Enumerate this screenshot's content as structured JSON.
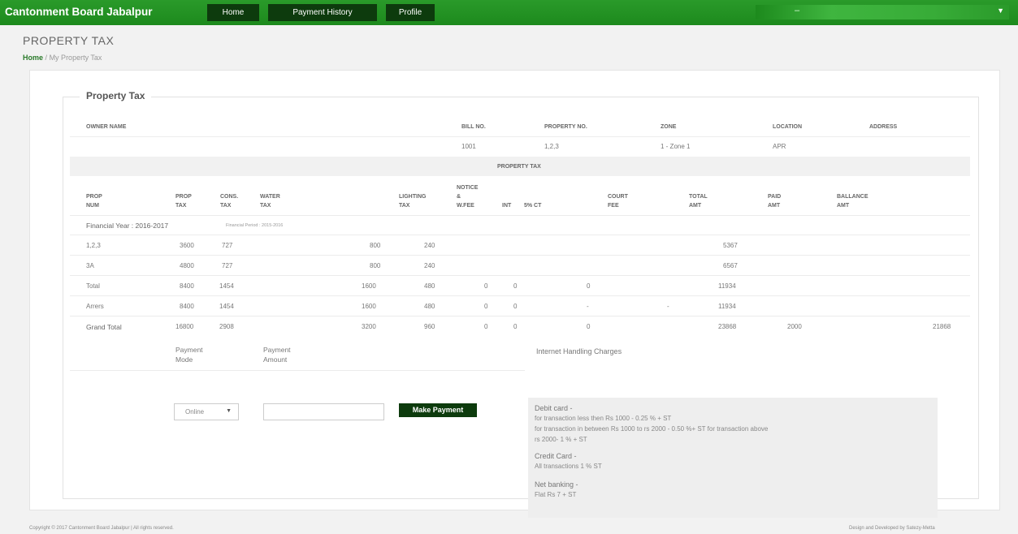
{
  "brand": "Cantonment Board Jabalpur",
  "nav": {
    "home": "Home",
    "payment_history": "Payment History",
    "profile": "Profile"
  },
  "user": {
    "name": "–",
    "caret": "▼"
  },
  "page": {
    "title": "PROPERTY TAX",
    "breadcrumb_home": "Home",
    "breadcrumb_sep": "/",
    "breadcrumb_current": "My Property Tax"
  },
  "panel": {
    "legend": "Property Tax"
  },
  "info": {
    "headers": {
      "owner": "OWNER NAME",
      "bill": "BILL NO.",
      "property": "PROPERTY NO.",
      "zone": "ZONE",
      "location": "LOCATION",
      "address": "ADDRESS"
    },
    "values": {
      "owner": "",
      "bill": "1001",
      "property": "1,2,3",
      "zone": "1 - Zone 1",
      "location": "APR",
      "address": ""
    }
  },
  "section_title": "PROPERTY TAX",
  "tax_headers": {
    "prop_num": [
      "PROP",
      "NUM"
    ],
    "prop_tax": [
      "PROP",
      "TAX"
    ],
    "cons_tax": [
      "CONS.",
      "TAX"
    ],
    "water_tax": [
      "WATER",
      "TAX"
    ],
    "lighting_tax": [
      "LIGHTING",
      "TAX"
    ],
    "notice": [
      "NOTICE",
      "&",
      "W.FEE"
    ],
    "int": [
      "INT"
    ],
    "ct": [
      "5% CT"
    ],
    "court_fee": [
      "COURT",
      "FEE"
    ],
    "total_amt": [
      "TOTAL",
      "AMT"
    ],
    "paid_amt": [
      "PAID",
      "AMT"
    ],
    "balance_amt": [
      "BALLANCE",
      "AMT"
    ]
  },
  "financial_year": {
    "label": "Financial Year : 2016-2017",
    "period": "Financial Period : 2015-2016"
  },
  "rows": [
    {
      "num": "1,2,3",
      "prop": "3600",
      "cons": "727",
      "water": "800",
      "light": "240",
      "notice": "",
      "int": "",
      "ct": "",
      "court": "",
      "total": "5367",
      "paid": "",
      "balance": ""
    },
    {
      "num": "3A",
      "prop": "4800",
      "cons": "727",
      "water": "800",
      "light": "240",
      "notice": "",
      "int": "",
      "ct": "",
      "court": "",
      "total": "6567",
      "paid": "",
      "balance": ""
    },
    {
      "num": "Total",
      "prop": "8400",
      "cons": "1454",
      "water": "1600",
      "light": "480",
      "notice": "0",
      "int": "0",
      "ct": "0",
      "court": "",
      "total": "11934",
      "paid": "",
      "balance": ""
    },
    {
      "num": "Arrers",
      "prop": "8400",
      "cons": "1454",
      "water": "1600",
      "light": "480",
      "notice": "0",
      "int": "0",
      "ct": "-",
      "court": "-",
      "total": "11934",
      "paid": "",
      "balance": ""
    },
    {
      "num": "Grand Total",
      "prop": "16800",
      "cons": "2908",
      "water": "3200",
      "light": "960",
      "notice": "0",
      "int": "0",
      "ct": "0",
      "court": "",
      "total": "23868",
      "paid": "2000",
      "balance": "21868"
    }
  ],
  "payment": {
    "mode_label": [
      "Payment",
      "Mode"
    ],
    "amount_label": [
      "Payment",
      "Amount"
    ],
    "mode_value": "Online",
    "mode_caret": "▼",
    "amount_value": "",
    "button": "Make Payment"
  },
  "charges": {
    "title": "Internet Handling Charges",
    "debit_title": "Debit card -",
    "debit_lines": [
      "for transaction less then Rs 1000 - 0.25 % + ST",
      "for transaction in between Rs 1000 to rs 2000 - 0.50 %+ ST for transaction above",
      "rs 2000- 1 % + ST"
    ],
    "credit_title": "Credit Card -",
    "credit_line": "All transactions 1 % ST",
    "net_title": "Net banking -",
    "net_line": "Flat Rs 7 + ST"
  },
  "footer": {
    "left": "Copyright © 2017 Cantonment Board Jabalpur | All rights reserved.",
    "right": "Design and Developed by Satezy-Metta"
  }
}
